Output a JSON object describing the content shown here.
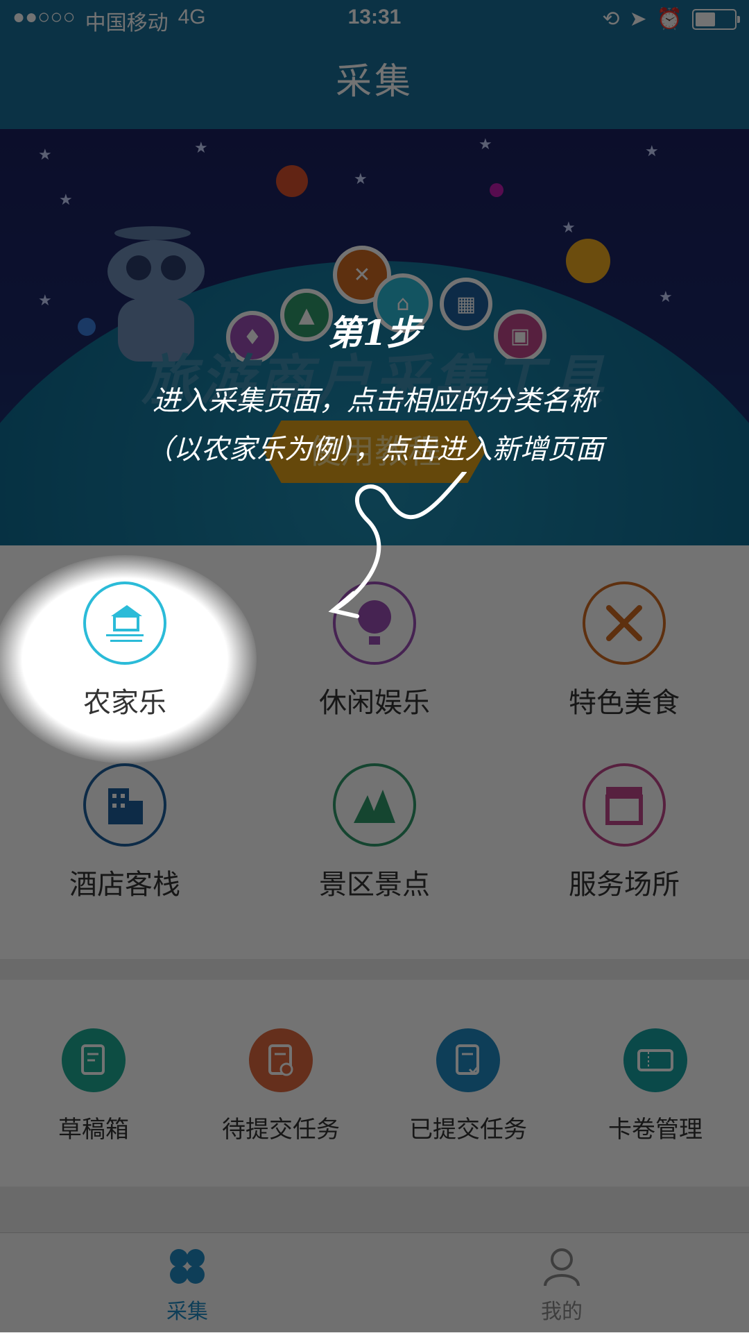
{
  "status_bar": {
    "signal": "●●○○○",
    "carrier": "中国移动",
    "network": "4G",
    "time": "13:31"
  },
  "nav": {
    "title": "采集"
  },
  "banner": {
    "title": "旅游商户采集工具",
    "tutorial_button": "使用教程"
  },
  "categories": [
    {
      "label": "农家乐",
      "icon": "farmhouse-icon",
      "color": "#2bbbd8"
    },
    {
      "label": "休闲娱乐",
      "icon": "balloon-icon",
      "color": "#9b4fb5"
    },
    {
      "label": "特色美食",
      "icon": "fork-knife-icon",
      "color": "#d06a23"
    },
    {
      "label": "酒店客栈",
      "icon": "hotel-icon",
      "color": "#1e5f9e"
    },
    {
      "label": "景区景点",
      "icon": "mountain-icon",
      "color": "#2f9a6a"
    },
    {
      "label": "服务场所",
      "icon": "store-icon",
      "color": "#c1478c"
    }
  ],
  "tasks": [
    {
      "label": "草稿箱",
      "icon": "draft-icon",
      "color": "#1eaa94"
    },
    {
      "label": "待提交任务",
      "icon": "pending-task-icon",
      "color": "#e0683f"
    },
    {
      "label": "已提交任务",
      "icon": "submitted-task-icon",
      "color": "#1f8bc4"
    },
    {
      "label": "卡卷管理",
      "icon": "coupon-icon",
      "color": "#18a3a3"
    }
  ],
  "tabbar": {
    "tabs": [
      {
        "label": "采集",
        "icon": "collect-icon",
        "active": true,
        "color": "#1f8bc4"
      },
      {
        "label": "我的",
        "icon": "profile-icon",
        "active": false,
        "color": "#8a8a8a"
      }
    ]
  },
  "guide": {
    "step": "第1步",
    "line1": "进入采集页面，点击相应的分类名称",
    "line2": "（以农家乐为例），点击进入新增页面"
  }
}
